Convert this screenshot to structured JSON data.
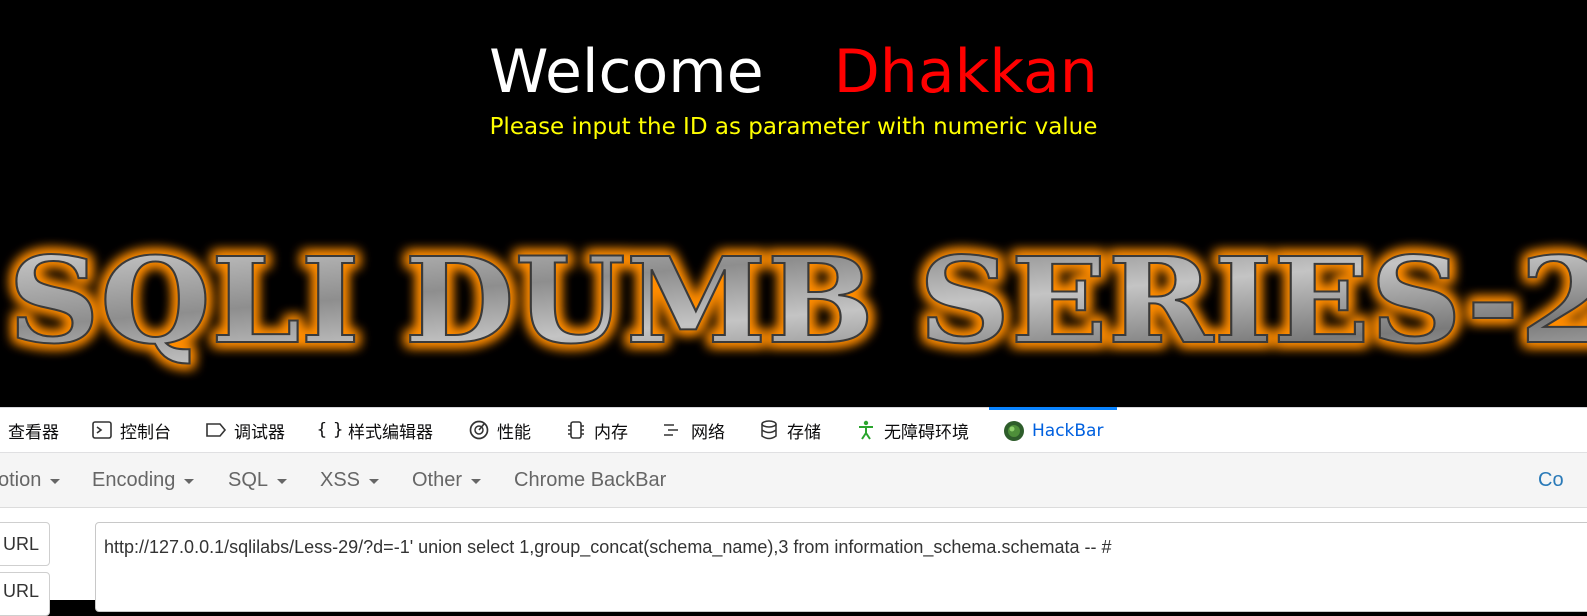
{
  "page": {
    "welcome_word": "Welcome",
    "user_word": "Dhakkan",
    "instruction": "Please input the ID as parameter with numeric value",
    "banner_text": "SQLI DUMB SERIES-2",
    "colors": {
      "background": "#000000",
      "welcome": "#ffffff",
      "user": "#ff0000",
      "instruction": "#ffff00",
      "banner_glow": "#ff8c00"
    }
  },
  "devtools": {
    "tabs": [
      {
        "label": "查看器",
        "icon": "inspector-icon"
      },
      {
        "label": "控制台",
        "icon": "console-icon"
      },
      {
        "label": "调试器",
        "icon": "debugger-icon"
      },
      {
        "label": "样式编辑器",
        "icon": "style-editor-icon"
      },
      {
        "label": "性能",
        "icon": "performance-icon"
      },
      {
        "label": "内存",
        "icon": "memory-icon"
      },
      {
        "label": "网络",
        "icon": "network-icon"
      },
      {
        "label": "存储",
        "icon": "storage-icon"
      },
      {
        "label": "无障碍环境",
        "icon": "accessibility-icon"
      },
      {
        "label": "HackBar",
        "icon": "hackbar-icon",
        "active": true
      }
    ]
  },
  "hackbar": {
    "menu": [
      "otion",
      "Encoding",
      "SQL",
      "XSS",
      "Other",
      "Chrome BackBar"
    ],
    "right_label": "Co",
    "load_url_label": "ad URL",
    "split_url_label": "lit URL",
    "url_value": "http://127.0.0.1/sqlilabs/Less-29/?d=-1' union select 1,group_concat(schema_name),3 from information_schema.schemata -- #"
  }
}
